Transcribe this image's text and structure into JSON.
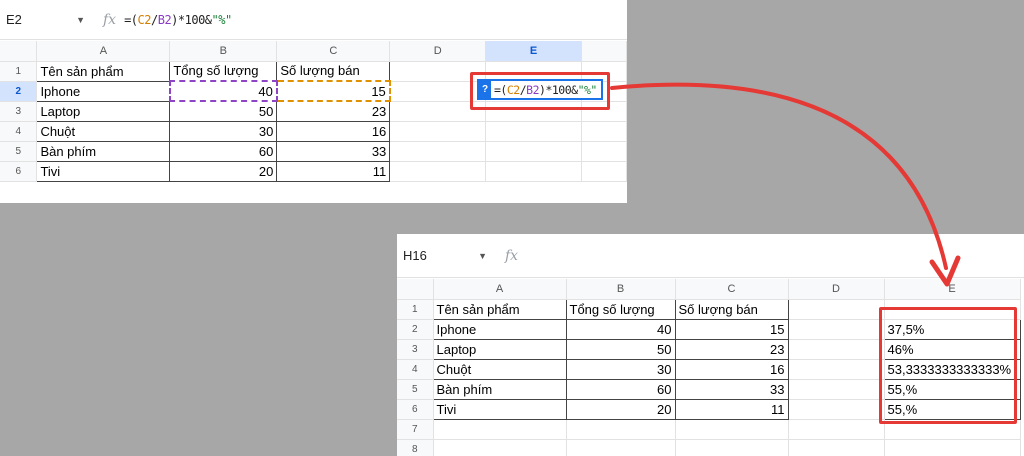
{
  "sheet1": {
    "name_box": "E2",
    "formula": {
      "p1": "=(",
      "p2": "C2",
      "p3": "/",
      "p4": "B2",
      "p5": ")*100&",
      "p6": "\"%\""
    },
    "columns": [
      "A",
      "B",
      "C",
      "D",
      "E"
    ],
    "rows": [
      {
        "n": "1",
        "a": "Tên sản phẩm",
        "b": "Tổng số lượng",
        "c": "Số lượng bán"
      },
      {
        "n": "2",
        "a": "Iphone",
        "b": "40",
        "c": "15"
      },
      {
        "n": "3",
        "a": "Laptop",
        "b": "50",
        "c": "23"
      },
      {
        "n": "4",
        "a": "Chuột",
        "b": "30",
        "c": "16"
      },
      {
        "n": "5",
        "a": "Bàn phím",
        "b": "60",
        "c": "33"
      },
      {
        "n": "6",
        "a": "Tivi",
        "b": "20",
        "c": "11"
      }
    ],
    "editor_badge": "?"
  },
  "sheet2": {
    "name_box": "H16",
    "columns": [
      "A",
      "B",
      "C",
      "D",
      "E"
    ],
    "rows": [
      {
        "n": "1",
        "a": "Tên sản phẩm",
        "b": "Tổng số lượng",
        "c": "Số lượng bán",
        "e": ""
      },
      {
        "n": "2",
        "a": "Iphone",
        "b": "40",
        "c": "15",
        "e": "37,5%"
      },
      {
        "n": "3",
        "a": "Laptop",
        "b": "50",
        "c": "23",
        "e": "46%"
      },
      {
        "n": "4",
        "a": "Chuột",
        "b": "30",
        "c": "16",
        "e": "53,3333333333333%"
      },
      {
        "n": "5",
        "a": "Bàn phím",
        "b": "60",
        "c": "33",
        "e": "55,%"
      },
      {
        "n": "6",
        "a": "Tivi",
        "b": "20",
        "c": "11",
        "e": "55,%"
      },
      {
        "n": "7"
      },
      {
        "n": "8"
      }
    ]
  },
  "colors": {
    "highlight": "#e53935",
    "selection": "#1a73e8"
  }
}
